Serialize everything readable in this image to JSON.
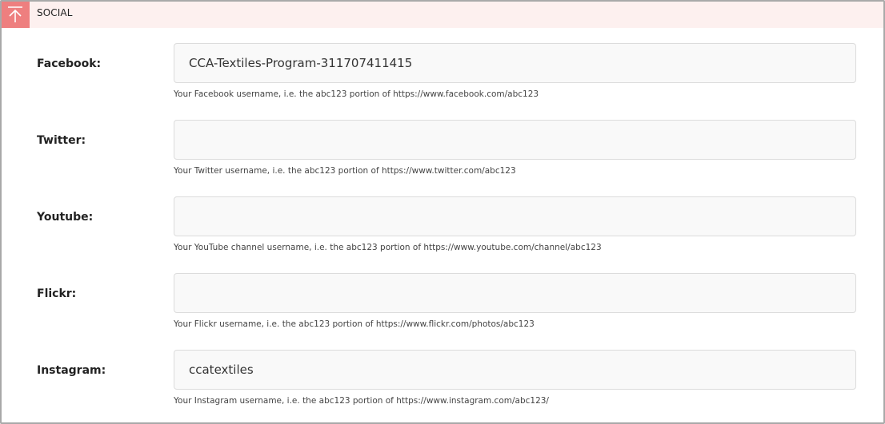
{
  "section": {
    "title": "SOCIAL",
    "collapse_icon": "collapse-up-arrow-icon",
    "accent_color": "#ee7f7f",
    "header_bg": "#fdf0ef"
  },
  "fields": [
    {
      "label": "Facebook:",
      "value": "CCA-Textiles-Program-311707411415",
      "placeholder": "",
      "help": "Your Facebook username, i.e. the abc123 portion of https://www.facebook.com/abc123"
    },
    {
      "label": "Twitter:",
      "value": "",
      "placeholder": "",
      "help": "Your Twitter username, i.e. the abc123 portion of https://www.twitter.com/abc123"
    },
    {
      "label": "Youtube:",
      "value": "",
      "placeholder": "",
      "help": "Your YouTube channel username, i.e. the abc123 portion of https://www.youtube.com/channel/abc123"
    },
    {
      "label": "Flickr:",
      "value": "",
      "placeholder": "",
      "help": "Your Flickr username, i.e. the abc123 portion of https://www.flickr.com/photos/abc123"
    },
    {
      "label": "Instagram:",
      "value": "ccatextiles",
      "placeholder": "",
      "help": "Your Instagram username, i.e. the abc123 portion of https://www.instagram.com/abc123/"
    }
  ]
}
